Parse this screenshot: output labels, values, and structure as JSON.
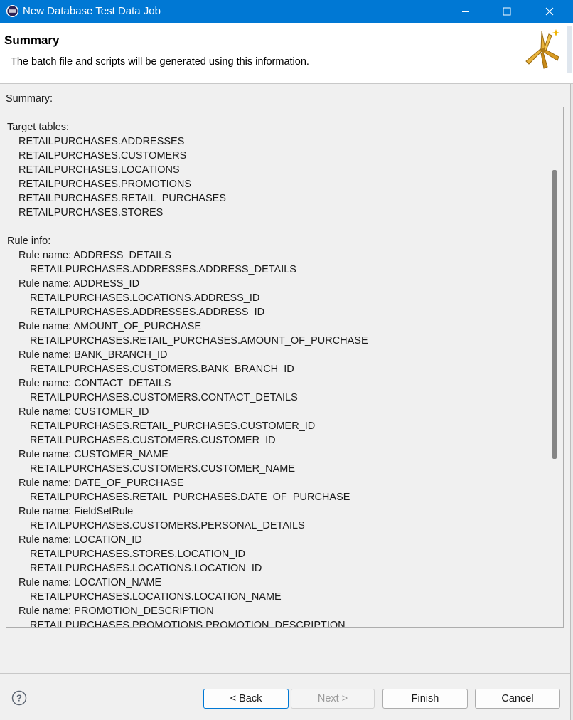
{
  "window": {
    "title": "New Database Test Data Job",
    "app_icon": "eclipse-icon",
    "controls": [
      "minimize-icon",
      "maximize-icon",
      "close-icon"
    ],
    "accent_color": "#0078d4"
  },
  "banner": {
    "heading": "Summary",
    "description": "The batch file and scripts will be generated using this information.",
    "logo": "wizard-wand-icon"
  },
  "summary": {
    "label": "Summary:",
    "lines": [
      {
        "text": "Target tables:",
        "indent": 0
      },
      {
        "text": "RETAILPURCHASES.ADDRESSES",
        "indent": 1
      },
      {
        "text": "RETAILPURCHASES.CUSTOMERS",
        "indent": 1
      },
      {
        "text": "RETAILPURCHASES.LOCATIONS",
        "indent": 1
      },
      {
        "text": "RETAILPURCHASES.PROMOTIONS",
        "indent": 1
      },
      {
        "text": "RETAILPURCHASES.RETAIL_PURCHASES",
        "indent": 1
      },
      {
        "text": "RETAILPURCHASES.STORES",
        "indent": 1
      },
      {
        "text": "",
        "indent": 0
      },
      {
        "text": "Rule info:",
        "indent": 0
      },
      {
        "text": "Rule name: ADDRESS_DETAILS",
        "indent": 1
      },
      {
        "text": "RETAILPURCHASES.ADDRESSES.ADDRESS_DETAILS",
        "indent": 2
      },
      {
        "text": "Rule name: ADDRESS_ID",
        "indent": 1
      },
      {
        "text": "RETAILPURCHASES.LOCATIONS.ADDRESS_ID",
        "indent": 2
      },
      {
        "text": "RETAILPURCHASES.ADDRESSES.ADDRESS_ID",
        "indent": 2
      },
      {
        "text": "Rule name: AMOUNT_OF_PURCHASE",
        "indent": 1
      },
      {
        "text": "RETAILPURCHASES.RETAIL_PURCHASES.AMOUNT_OF_PURCHASE",
        "indent": 2
      },
      {
        "text": "Rule name: BANK_BRANCH_ID",
        "indent": 1
      },
      {
        "text": "RETAILPURCHASES.CUSTOMERS.BANK_BRANCH_ID",
        "indent": 2
      },
      {
        "text": "Rule name: CONTACT_DETAILS",
        "indent": 1
      },
      {
        "text": "RETAILPURCHASES.CUSTOMERS.CONTACT_DETAILS",
        "indent": 2
      },
      {
        "text": "Rule name: CUSTOMER_ID",
        "indent": 1
      },
      {
        "text": "RETAILPURCHASES.RETAIL_PURCHASES.CUSTOMER_ID",
        "indent": 2
      },
      {
        "text": "RETAILPURCHASES.CUSTOMERS.CUSTOMER_ID",
        "indent": 2
      },
      {
        "text": "Rule name: CUSTOMER_NAME",
        "indent": 1
      },
      {
        "text": "RETAILPURCHASES.CUSTOMERS.CUSTOMER_NAME",
        "indent": 2
      },
      {
        "text": "Rule name: DATE_OF_PURCHASE",
        "indent": 1
      },
      {
        "text": "RETAILPURCHASES.RETAIL_PURCHASES.DATE_OF_PURCHASE",
        "indent": 2
      },
      {
        "text": "Rule name: FieldSetRule",
        "indent": 1
      },
      {
        "text": "RETAILPURCHASES.CUSTOMERS.PERSONAL_DETAILS",
        "indent": 2
      },
      {
        "text": "Rule name: LOCATION_ID",
        "indent": 1
      },
      {
        "text": "RETAILPURCHASES.STORES.LOCATION_ID",
        "indent": 2
      },
      {
        "text": "RETAILPURCHASES.LOCATIONS.LOCATION_ID",
        "indent": 2
      },
      {
        "text": "Rule name: LOCATION_NAME",
        "indent": 1
      },
      {
        "text": "RETAILPURCHASES.LOCATIONS.LOCATION_NAME",
        "indent": 2
      },
      {
        "text": "Rule name: PROMOTION_DESCRIPTION",
        "indent": 1
      },
      {
        "text": "RETAILPURCHASES.PROMOTIONS.PROMOTION_DESCRIPTION",
        "indent": 2
      }
    ]
  },
  "footer": {
    "help_icon": "help-icon",
    "buttons": {
      "back": "< Back",
      "next": "Next >",
      "finish": "Finish",
      "cancel": "Cancel"
    }
  }
}
